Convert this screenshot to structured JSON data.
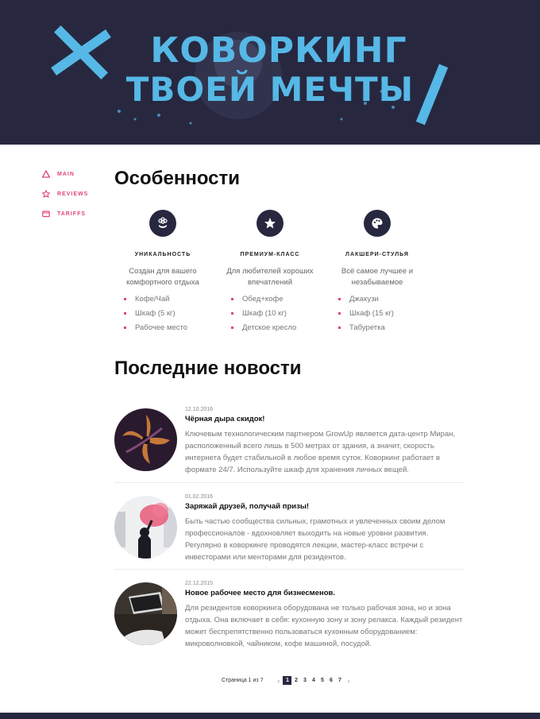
{
  "hero": {
    "line1": "КОВОРКИНГ",
    "line2": "ТВОЕЙ МЕЧТЫ"
  },
  "sidebar": {
    "items": [
      {
        "label": "main",
        "icon": "triangle-icon"
      },
      {
        "label": "reviews",
        "icon": "star-icon"
      },
      {
        "label": "tariffs",
        "icon": "wallet-icon"
      }
    ]
  },
  "features": {
    "title": "Особенности",
    "items": [
      {
        "icon": "flower-icon",
        "title": "Уникальность",
        "desc": "Создан для вашего комфортного отдыха",
        "list": [
          "Кофе/Чай",
          "Шкаф (5 кг)",
          "Рабочее место"
        ]
      },
      {
        "icon": "star-icon",
        "title": "Премиум-класс",
        "desc": "Для любителей хороших впечатлений",
        "list": [
          "Обед+кофе",
          "Шкаф (10 кг)",
          "Детское кресло"
        ]
      },
      {
        "icon": "palette-icon",
        "title": "Лакшери-стулья",
        "desc": "Всё самое лучшее и незабываемое",
        "list": [
          "Джакузи",
          "Шкаф (15 кг)",
          "Табуретка"
        ]
      }
    ]
  },
  "news": {
    "title": "Последние новости",
    "items": [
      {
        "date": "12.10.2016",
        "title": "Чёрная дыра скидок!",
        "text": "Ключевым технологическим партнером GrowUp является дата-центр Миран, расположенный всего лишь в 500 метрах от здания, а значит, скорость интернета будет стабильной в любое время суток. Коворкинг работает в формате 24/7. Используйте шкаф для хранения личных вещей."
      },
      {
        "date": "01.02.2016",
        "title": "Заряжай друзей, получай призы!",
        "text": "Быть частью сообщества сильных, грамотных и увлеченных своим делом профессионалов - вдохновляет выходить на новые уровни развития. Регулярно в коворкинге проводятся лекции, мастер-класс встречи с инвесторами или менторами для резидентов."
      },
      {
        "date": "22.12.2015",
        "title": "Новое рабочее место для бизнесменов.",
        "text": "Для резидентов коворкинга оборудована не только рабочая зона, но и зона отдыха. Она включает в себя: кухонную зону и зону релакса. Каждый резидент может беспрепятственно пользоваться кухонным оборудованием: микроволновкой, чайником, кофе машиной, посудой."
      }
    ]
  },
  "pagination": {
    "label": "Страница 1 из 7",
    "prev": "‹",
    "next": "›",
    "pages": [
      "1",
      "2",
      "3",
      "4",
      "5",
      "6",
      "7"
    ],
    "current": "1"
  },
  "colors": {
    "dark": "#272840",
    "accent": "#e0457b",
    "hero_text": "#56b8e6"
  }
}
